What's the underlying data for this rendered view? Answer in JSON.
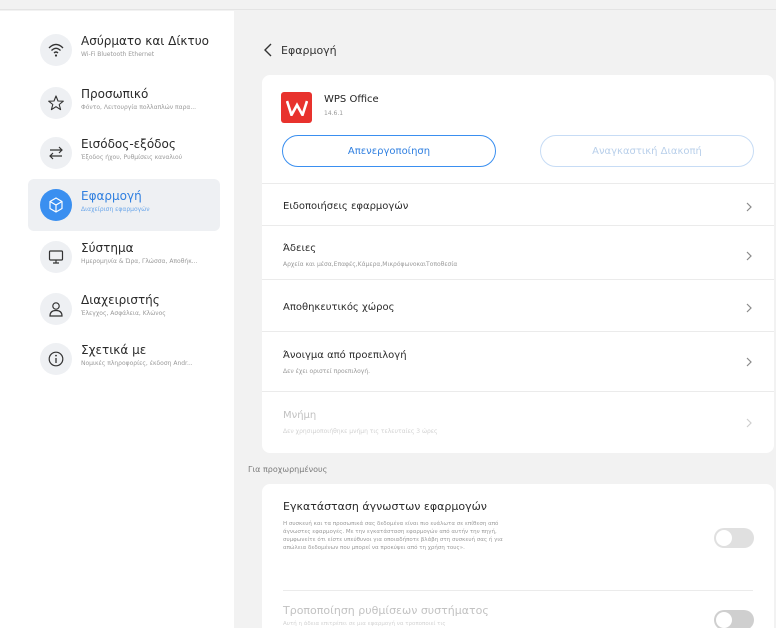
{
  "sidebar": {
    "items": [
      {
        "title": "Ασύρματο και Δίκτυο",
        "subtitle": "Wi-Fi Bluetooth Ethernet",
        "icon": "wifi-icon"
      },
      {
        "title": "Προσωπικό",
        "subtitle": "Φόντο, Λειτουργία πολλαπλών παρα...",
        "icon": "star-icon"
      },
      {
        "title": "Εισόδος-εξόδος",
        "subtitle": "Έξοδος ήχου, Ρυθμίσεις καναλιού",
        "icon": "swap-arrows-icon"
      },
      {
        "title": "Εφαρμογή",
        "subtitle": "Διαχείριση εφαρμογών",
        "icon": "cube-icon",
        "active": true
      },
      {
        "title": "Σύστημα",
        "subtitle": "Ημερομηνία & Ώρα, Γλώσσα, Αποθήκ...",
        "icon": "monitor-icon"
      },
      {
        "title": "Διαχειριστής",
        "subtitle": "Έλεγχος, Ασφάλεια, Κλώνος",
        "icon": "user-icon"
      },
      {
        "title": "Σχετικά με",
        "subtitle": "Νομικές πληροφορίες, έκδοση Andr...",
        "icon": "info-icon"
      }
    ]
  },
  "header": {
    "title": "Εφαρμογή"
  },
  "app": {
    "name": "WPS Office",
    "version": "14.6.1"
  },
  "buttons": {
    "disable": "Απενεργοποίηση",
    "force_stop": "Αναγκαστική Διακοπή"
  },
  "rows": [
    {
      "title": "Ειδοποιήσεις εφαρμογών",
      "subtitle": ""
    },
    {
      "title": "Άδειες",
      "subtitle": "Αρχεία και μέσα,Επαφές,Κάμερα,ΜικρόφωνοκαιΤοποθεσία"
    },
    {
      "title": "Αποθηκευτικός χώρος",
      "subtitle": ""
    },
    {
      "title": "Άνοιγμα από προεπιλογή",
      "subtitle": "Δεν έχει οριστεί προεπιλογή."
    },
    {
      "title": "Μνήμη",
      "subtitle": "Δεν χρησιμοποιήθηκε μνήμη τις τελευταίες 3 ώρες"
    }
  ],
  "advanced": {
    "label": "Για προχωρημένους",
    "install_unknown": {
      "title": "Εγκατάσταση άγνωστων εφαρμογών",
      "description": "Η συσκευή και τα προσωπικά σας δεδομένα είναι πιο ευάλωτα σε επίθεση από άγνωστες εφαρμογές. Με την εγκατάσταση εφαρμογών από αυτήν την πηγή, συμφωνείτε ότι είστε υπεύθυνοι για οποιαδήποτε βλάβη στη συσκευή σας ή για απώλεια δεδομένων που μπορεί να προκύψει από τη χρήση τους».",
      "enabled": false
    },
    "modify_settings": {
      "title": "Τροποποίηση ρυθμίσεων συστήματος",
      "description": "Αυτή η άδεια επιτρέπει σε μια εφαρμογή να τροποποιεί τις",
      "enabled": false
    }
  },
  "colors": {
    "accent": "#3a8ff0",
    "wps_red": "#e8322d"
  }
}
